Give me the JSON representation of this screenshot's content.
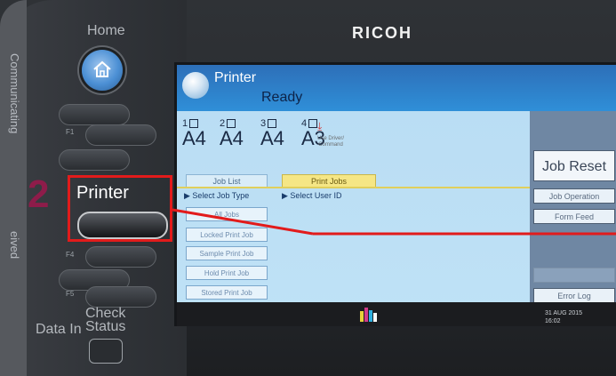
{
  "device": {
    "brand": "RICOH",
    "side_labels": [
      "Communicating",
      "eived"
    ],
    "buttons": {
      "home": "Home",
      "f1": "F1",
      "f4": "F4",
      "f5": "F5",
      "printer": "Printer",
      "check_status": [
        "Check",
        "Status"
      ],
      "data_in": "Data In"
    },
    "step_number": "2"
  },
  "screen": {
    "title": "Printer",
    "status": "Ready",
    "trays": [
      {
        "num": "1",
        "size": "A4"
      },
      {
        "num": "2",
        "size": "A4"
      },
      {
        "num": "3",
        "size": "A4"
      },
      {
        "num": "4",
        "size": "A3"
      }
    ],
    "driver_text": [
      "Use Driver/",
      "Command"
    ],
    "tabs": [
      {
        "label": "Job List",
        "active": false
      },
      {
        "label": "Print Jobs",
        "active": true
      }
    ],
    "select_job_type": "▶ Select Job Type",
    "select_user_id": "▶ Select User ID",
    "job_buttons": [
      "All Jobs",
      "Locked Print Job",
      "Sample Print Job",
      "Hold Print Job",
      "Stored Print Job"
    ],
    "right_panel": {
      "job_reset": "Job Reset",
      "job_operation": "Job Operation",
      "form_feed": "Form Feed",
      "error_log": "Error Log"
    },
    "date": [
      "31 AUG  2015",
      "16:02"
    ]
  },
  "colors": {
    "screen_bg": "#bfe2f6",
    "header_blue": "#2f7fc8",
    "highlight_red": "#e21b1b",
    "step_color": "#8e1c4a"
  }
}
